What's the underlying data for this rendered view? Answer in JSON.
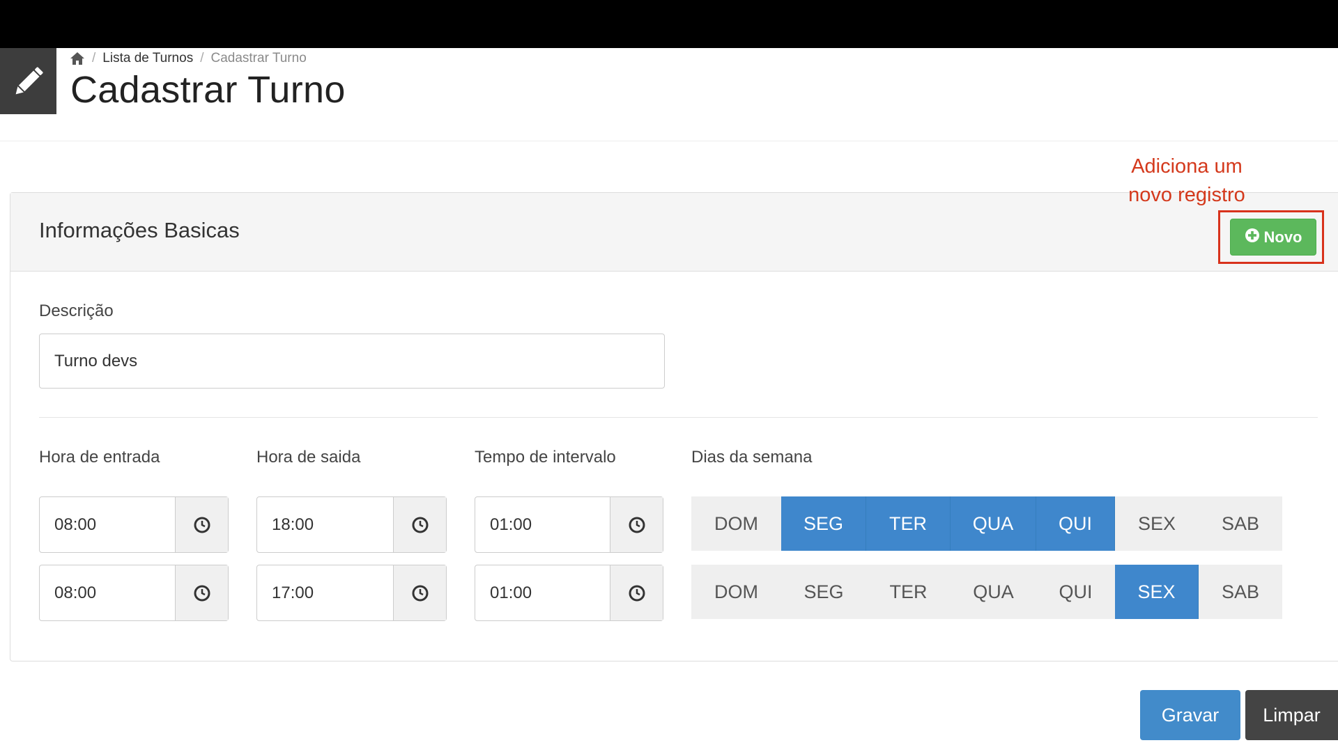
{
  "breadcrumb": {
    "home_icon": "home-icon",
    "items": [
      "Lista de Turnos",
      "Cadastrar Turno"
    ]
  },
  "page": {
    "icon": "pencil-icon",
    "title": "Cadastrar Turno"
  },
  "annotation": {
    "line1": "Adiciona um",
    "line2": "novo registro"
  },
  "panel": {
    "title": "Informações Basicas",
    "new_button": {
      "icon": "plus-circle-icon",
      "label": "Novo"
    }
  },
  "form": {
    "descricao_label": "Descrição",
    "descricao_value": "Turno devs",
    "hora_entrada_label": "Hora de entrada",
    "hora_saida_label": "Hora de saida",
    "tempo_intervalo_label": "Tempo de intervalo",
    "dias_semana_label": "Dias da semana"
  },
  "rows": [
    {
      "hora_entrada": "08:00",
      "hora_saida": "18:00",
      "tempo_intervalo": "01:00",
      "days": [
        {
          "label": "DOM",
          "selected": false
        },
        {
          "label": "SEG",
          "selected": true
        },
        {
          "label": "TER",
          "selected": true
        },
        {
          "label": "QUA",
          "selected": true
        },
        {
          "label": "QUI",
          "selected": true
        },
        {
          "label": "SEX",
          "selected": false
        },
        {
          "label": "SAB",
          "selected": false
        }
      ]
    },
    {
      "hora_entrada": "08:00",
      "hora_saida": "17:00",
      "tempo_intervalo": "01:00",
      "days": [
        {
          "label": "DOM",
          "selected": false
        },
        {
          "label": "SEG",
          "selected": false
        },
        {
          "label": "TER",
          "selected": false
        },
        {
          "label": "QUA",
          "selected": false
        },
        {
          "label": "QUI",
          "selected": false
        },
        {
          "label": "SEX",
          "selected": true
        },
        {
          "label": "SAB",
          "selected": false
        }
      ]
    }
  ],
  "actions": {
    "save_label": "Gravar",
    "clear_label": "Limpar"
  },
  "colors": {
    "selected_day": "#3f87cc",
    "new_button": "#5cb85c",
    "save_button": "#428bca",
    "clear_button": "#444444",
    "annotation": "#d4391c"
  }
}
